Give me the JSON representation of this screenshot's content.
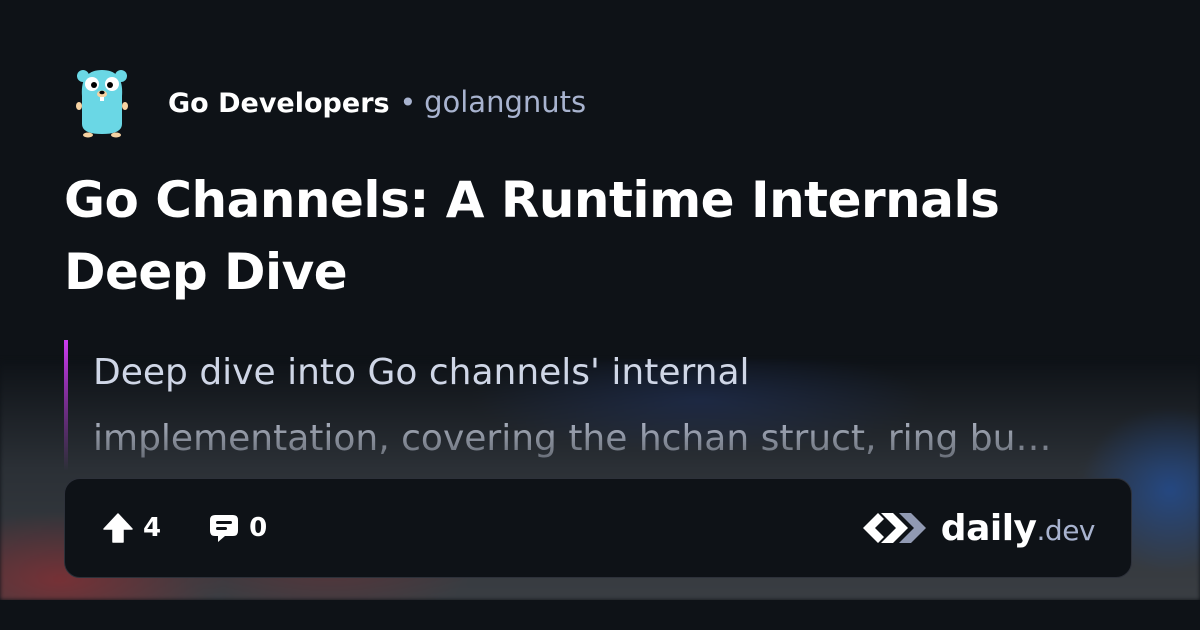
{
  "source": {
    "name": "Go Developers",
    "separator": "•",
    "handle": "golangnuts",
    "logo_icon": "gopher-mascot-icon"
  },
  "post": {
    "title": "Go Channels: A Runtime Internals Deep Dive",
    "summary_lines": [
      "Deep dive into Go channels' internal",
      "implementation, covering the hchan struct, ring bu…"
    ]
  },
  "stats": {
    "upvotes": "4",
    "upvote_icon": "upvote-arrow-icon",
    "comments": "0",
    "comment_icon": "comment-bubble-icon"
  },
  "brand": {
    "word": "daily",
    "tld": ".dev",
    "logo_icon": "daily-dev-logo-icon"
  },
  "colors": {
    "background": "#0e1217",
    "accent": "#ce3df3",
    "muted_text": "#a8b3cf"
  }
}
